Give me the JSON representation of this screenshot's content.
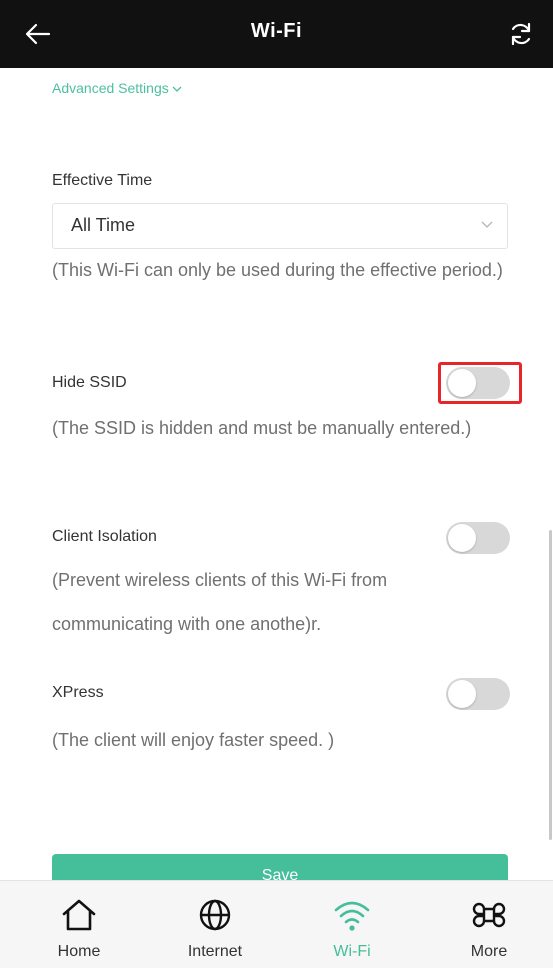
{
  "header": {
    "title": "Wi-Fi",
    "back_icon": "arrow-left-icon",
    "refresh_icon": "refresh-icon",
    "background": "#111111"
  },
  "advanced_settings": {
    "label": "Advanced Settings",
    "icon": "chevron-down-icon",
    "color": "#4cbf9f"
  },
  "effective_time": {
    "label": "Effective Time",
    "value": "All Time",
    "description": "(This Wi-Fi can only be used during the effective period.)"
  },
  "hide_ssid": {
    "label": "Hide SSID",
    "enabled": false,
    "description": "(The SSID is hidden and must be manually entered.)"
  },
  "client_isolation": {
    "label": "Client Isolation",
    "enabled": false,
    "description": "(Prevent wireless clients of this Wi-Fi from communicating with one anothe)r."
  },
  "xpress": {
    "label": "XPress",
    "enabled": false,
    "description": "(The client will enjoy faster speed. )"
  },
  "save": {
    "label": "Save",
    "color": "#44bf9a"
  },
  "tabs": [
    {
      "label": "Home",
      "icon": "home-icon",
      "active": false
    },
    {
      "label": "Internet",
      "icon": "globe-icon",
      "active": false
    },
    {
      "label": "Wi-Fi",
      "icon": "wifi-icon",
      "active": true
    },
    {
      "label": "More",
      "icon": "command-icon",
      "active": false
    }
  ],
  "highlight_color": "#e8262a"
}
